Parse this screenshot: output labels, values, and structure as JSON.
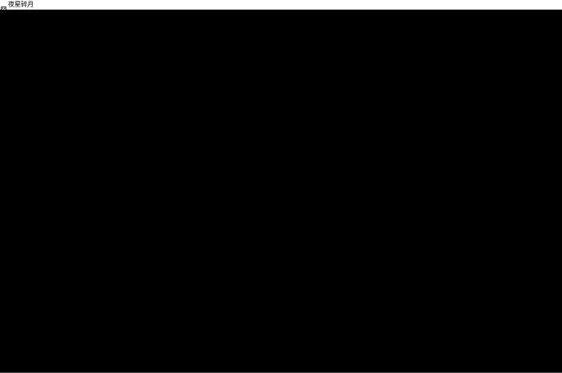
{
  "window": {
    "title": "夜星碎月",
    "app_icon": "game-app-icon"
  },
  "colors": {
    "titlebar_background": "#ffffff",
    "titlebar_text": "#000000",
    "content_background": "#000000"
  }
}
